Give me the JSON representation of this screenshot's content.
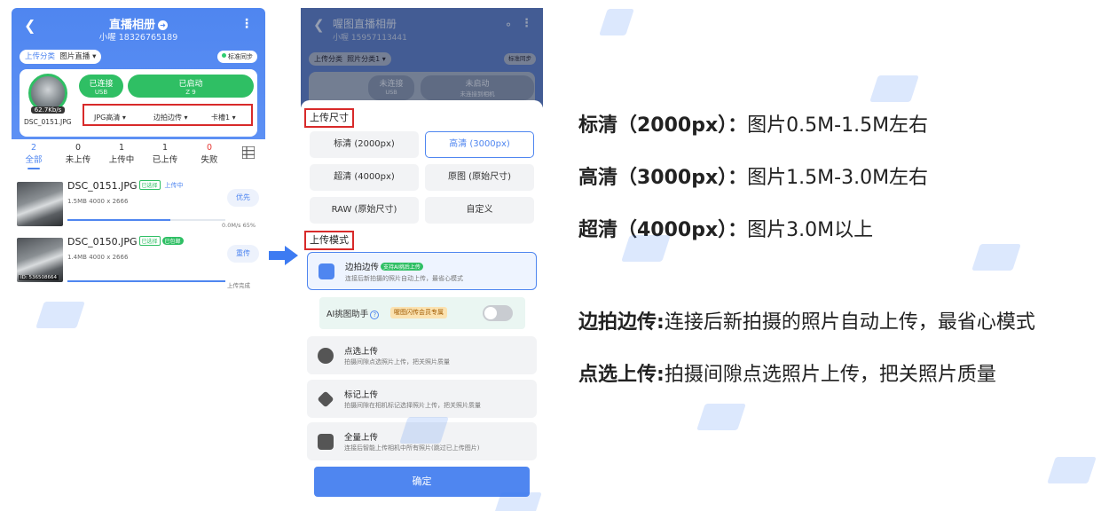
{
  "left_phone": {
    "title": "直播相册",
    "subtitle": "小喔 18326765189",
    "category_label": "上传分类",
    "category_value": "图片直播",
    "sync": "标准同步",
    "connect_btn": {
      "title": "已连接",
      "sub": "USB"
    },
    "start_btn": {
      "title": "已启动",
      "sub": "Z 9"
    },
    "avatar_speed": "62.7Kb/s",
    "current_file": "DSC_0151.JPG",
    "options": [
      "JPG高清",
      "边拍边传",
      "卡槽1"
    ],
    "stats": [
      {
        "count": "2",
        "label": "全部"
      },
      {
        "count": "0",
        "label": "未上传"
      },
      {
        "count": "1",
        "label": "上传中"
      },
      {
        "count": "1",
        "label": "已上传"
      },
      {
        "count": "0",
        "label": "失败"
      }
    ],
    "photos": [
      {
        "name": "DSC_0151.JPG",
        "tag": "已选择",
        "status": "上传中",
        "meta": "1.5MB  4000 x 2666",
        "button": "优先",
        "speed": "0.0M/s  65%",
        "progress": 0.65,
        "id": ""
      },
      {
        "name": "DSC_0150.JPG",
        "tag": "已选择",
        "status": "已包邮",
        "meta": "1.4MB  4000 x 2666",
        "button": "重传",
        "speed": "上传完成",
        "progress": 1.0,
        "id": "ID: 536508664"
      }
    ]
  },
  "right_phone": {
    "title": "喔图直播相册",
    "subtitle": "小喔 15957113441",
    "category_label": "上传分类",
    "category_value": "照片分类1",
    "sync": "标准同步",
    "connect_btn": {
      "title": "未连接",
      "sub": "USB"
    },
    "start_btn": {
      "title": "未启动",
      "sub": "未连接到相机"
    },
    "size_section": "上传尺寸",
    "sizes": [
      "标清 (2000px)",
      "高清 (3000px)",
      "超清 (4000px)",
      "原图 (原始尺寸)",
      "RAW (原始尺寸)",
      "自定义"
    ],
    "selected_size": "高清 (3000px)",
    "mode_section": "上传模式",
    "modes": [
      {
        "title": "边拍边传",
        "badge": "支持AI挑后上传",
        "desc": "连接后新拍摄的照片自动上传，最省心模式",
        "selected": true
      },
      {
        "title": "点选上传",
        "desc": "拍摄间隙点选照片上传，把关照片质量",
        "selected": false
      },
      {
        "title": "标记上传",
        "desc": "拍摄间隙在相机标记选择照片上传，把关照片质量",
        "selected": false
      },
      {
        "title": "全量上传",
        "desc": "连接后智能上传相机中所有照片(跳过已上传图片)",
        "selected": false
      }
    ],
    "ai_label": "AI挑图助手",
    "ai_vip": "喔图闪传会员专属",
    "ai_enabled": false,
    "confirm": "确定"
  },
  "notes": {
    "size1_label": "标清（2000px）：",
    "size1_text": "图片0.5M-1.5M左右",
    "size2_label": "高清（3000px）：",
    "size2_text": "图片1.5M-3.0M左右",
    "size3_label": "超清（4000px）：",
    "size3_text": "图片3.0M以上",
    "mode1_label": "边拍边传:",
    "mode1_text": "连接后新拍摄的照片自动上传，最省心模式",
    "mode2_label": "点选上传:",
    "mode2_text": "拍摄间隙点选照片上传，把关照片质量"
  },
  "colors": {
    "accent": "#4f86f0",
    "green": "#2fbf64",
    "highlight": "#d82a2a"
  },
  "watermark": "喔图"
}
